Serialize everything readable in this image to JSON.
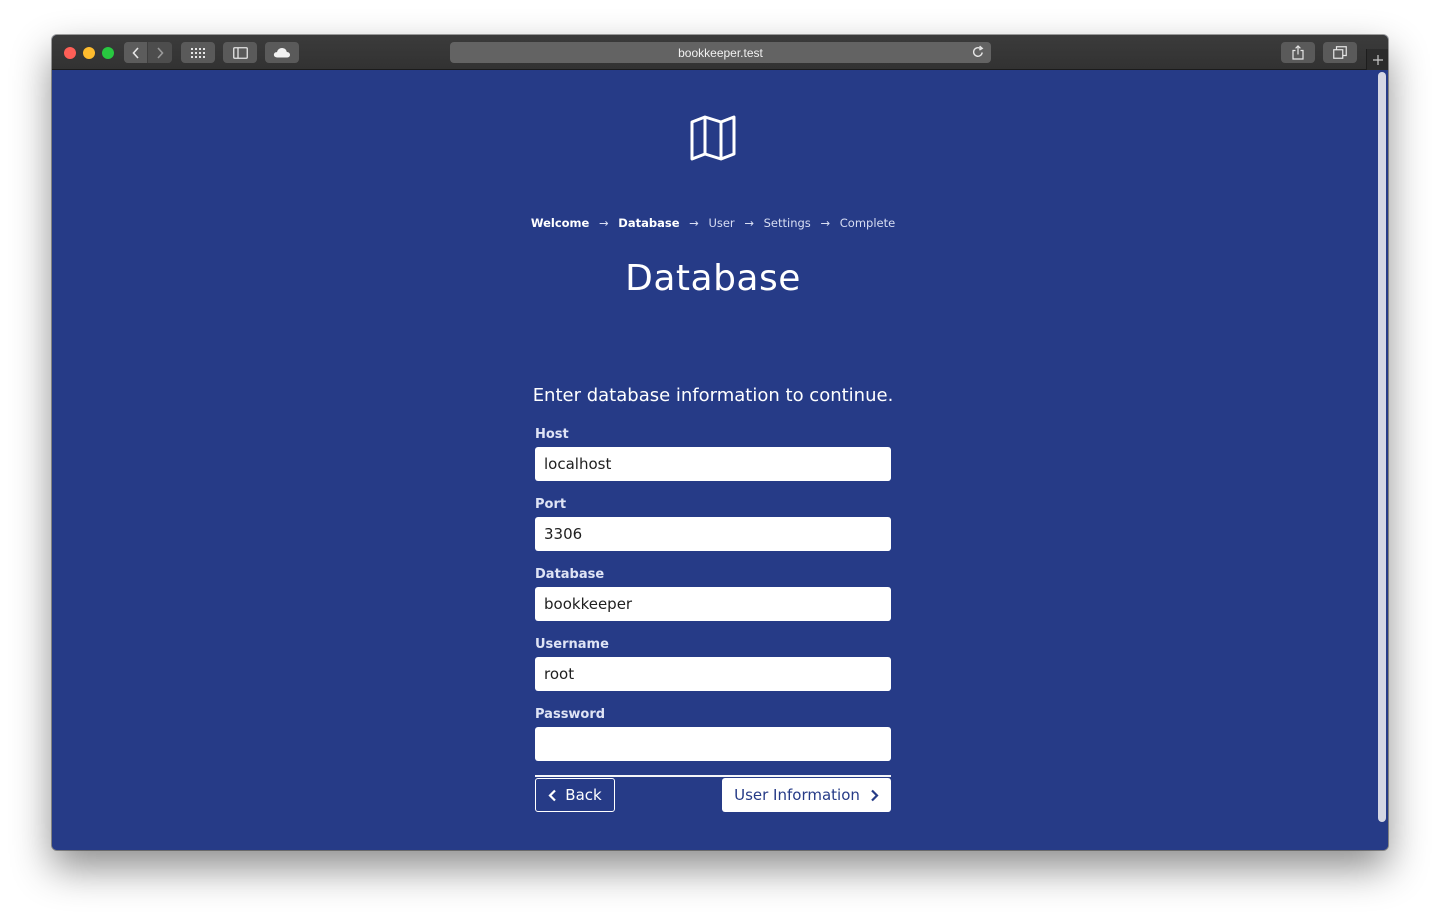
{
  "browser": {
    "url": "bookkeeper.test"
  },
  "breadcrumb": [
    {
      "label": "Welcome",
      "state": "done"
    },
    {
      "label": "Database",
      "state": "current"
    },
    {
      "label": "User",
      "state": "pending"
    },
    {
      "label": "Settings",
      "state": "pending"
    },
    {
      "label": "Complete",
      "state": "pending"
    }
  ],
  "page": {
    "title": "Database",
    "intro": "Enter database information to continue."
  },
  "form": {
    "host": {
      "label": "Host",
      "value": "localhost"
    },
    "port": {
      "label": "Port",
      "value": "3306"
    },
    "database": {
      "label": "Database",
      "value": "bookkeeper"
    },
    "username": {
      "label": "Username",
      "value": "root"
    },
    "password": {
      "label": "Password",
      "value": ""
    }
  },
  "actions": {
    "back_label": "Back",
    "next_label": "User Information"
  },
  "colors": {
    "background": "#263b87",
    "accent": "#ffffff"
  },
  "icons": {
    "logo": "folded-map-icon",
    "back": "chevron-left-icon",
    "next": "chevron-right-icon",
    "reload": "reload-icon",
    "share": "share-icon",
    "tabs": "tab-overview-icon"
  }
}
